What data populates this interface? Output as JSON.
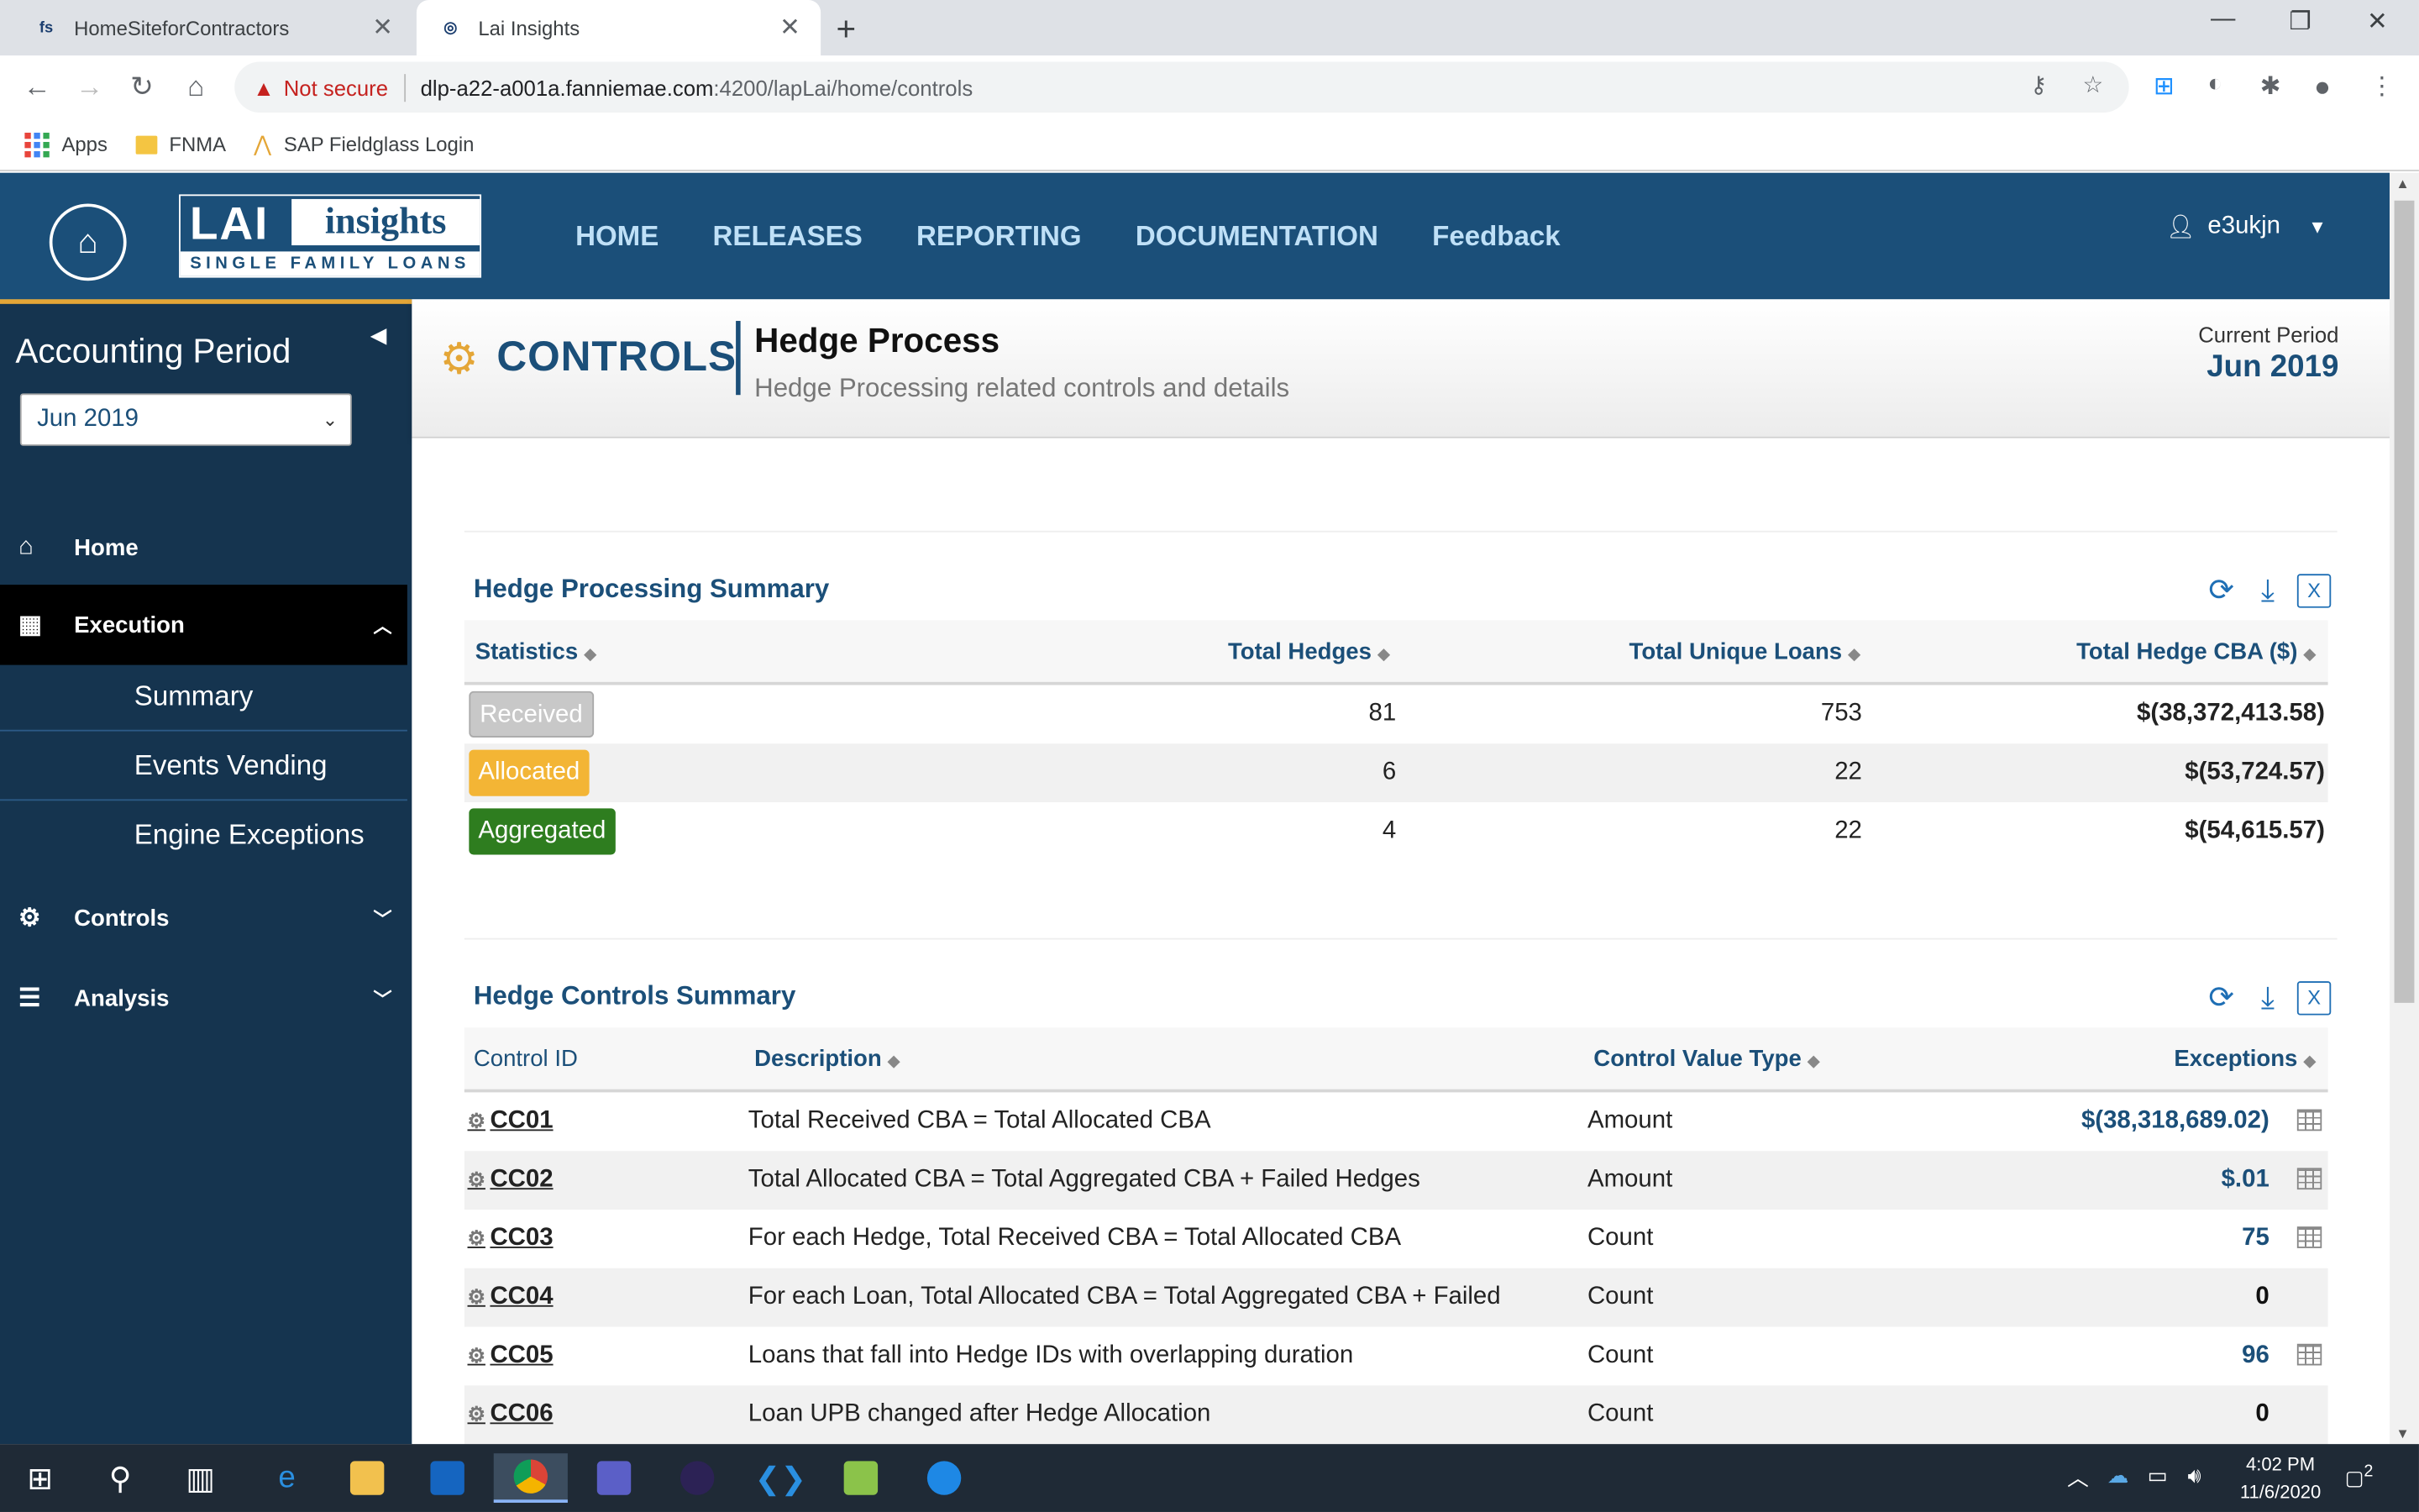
{
  "browser": {
    "tabs": [
      {
        "title": "HomeSiteforContractors",
        "favicon": "fs"
      },
      {
        "title": "Lai Insights",
        "favicon": "globe-icon"
      }
    ],
    "url_warning": "Not secure",
    "url_host": "dlp-a22-a001a.fanniemae.com",
    "url_path": ":4200/lapLai/home/controls",
    "bookmarks": [
      "Apps",
      "FNMA",
      "SAP Fieldglass Login"
    ]
  },
  "app": {
    "logo_main": "LAI",
    "logo_insights": "insights",
    "logo_sub": "SINGLE FAMILY LOANS",
    "nav": [
      "HOME",
      "RELEASES",
      "REPORTING",
      "DOCUMENTATION",
      "Feedback"
    ],
    "user": "e3ukjn"
  },
  "sidebar": {
    "title": "Accounting Period",
    "period_selected": "Jun 2019",
    "items": [
      {
        "label": "Home",
        "icon": "home-icon"
      },
      {
        "label": "Execution",
        "icon": "calendar-icon"
      },
      {
        "label": "Controls",
        "icon": "gears-icon"
      },
      {
        "label": "Analysis",
        "icon": "database-icon"
      }
    ],
    "execution_sub": [
      "Summary",
      "Events Vending",
      "Engine Exceptions"
    ]
  },
  "page": {
    "section": "CONTROLS",
    "title": "Hedge Process",
    "subtitle": "Hedge Processing related controls and details",
    "current_period_label": "Current Period",
    "current_period_value": "Jun 2019"
  },
  "summary": {
    "title": "Hedge Processing Summary",
    "headers": [
      "Statistics",
      "Total Hedges",
      "Total Unique Loans",
      "Total Hedge CBA ($)"
    ],
    "rows": [
      {
        "status": "Received",
        "hedges": "81",
        "loans": "753",
        "cba": "$(38,372,413.58)",
        "color": "#c8c8c8"
      },
      {
        "status": "Allocated",
        "hedges": "6",
        "loans": "22",
        "cba": "$(53,724.57)",
        "color": "#f3b535"
      },
      {
        "status": "Aggregated",
        "hedges": "4",
        "loans": "22",
        "cba": "$(54,615.57)",
        "color": "#2e7d1f"
      }
    ]
  },
  "controls": {
    "title": "Hedge Controls Summary",
    "headers": [
      "Control ID",
      "Description",
      "Control Value Type",
      "Exceptions"
    ],
    "rows": [
      {
        "id": "CC01",
        "desc": "Total Received CBA = Total Allocated CBA",
        "type": "Amount",
        "exc": "$(38,318,689.02)"
      },
      {
        "id": "CC02",
        "desc": "Total Allocated CBA = Total Aggregated CBA + Failed Hedges",
        "type": "Amount",
        "exc": "$.01"
      },
      {
        "id": "CC03",
        "desc": "For each Hedge, Total Received CBA = Total Allocated CBA",
        "type": "Count",
        "exc": "75"
      },
      {
        "id": "CC04",
        "desc": "For each Loan, Total Allocated CBA = Total Aggregated CBA + Failed",
        "type": "Count",
        "exc": "0"
      },
      {
        "id": "CC05",
        "desc": "Loans that fall into Hedge IDs with overlapping duration",
        "type": "Count",
        "exc": "96"
      },
      {
        "id": "CC06",
        "desc": "Loan UPB changed after Hedge Allocation",
        "type": "Count",
        "exc": "0"
      }
    ]
  },
  "taskbar": {
    "time": "4:02 PM",
    "date": "11/6/2020",
    "notifications": "2"
  }
}
